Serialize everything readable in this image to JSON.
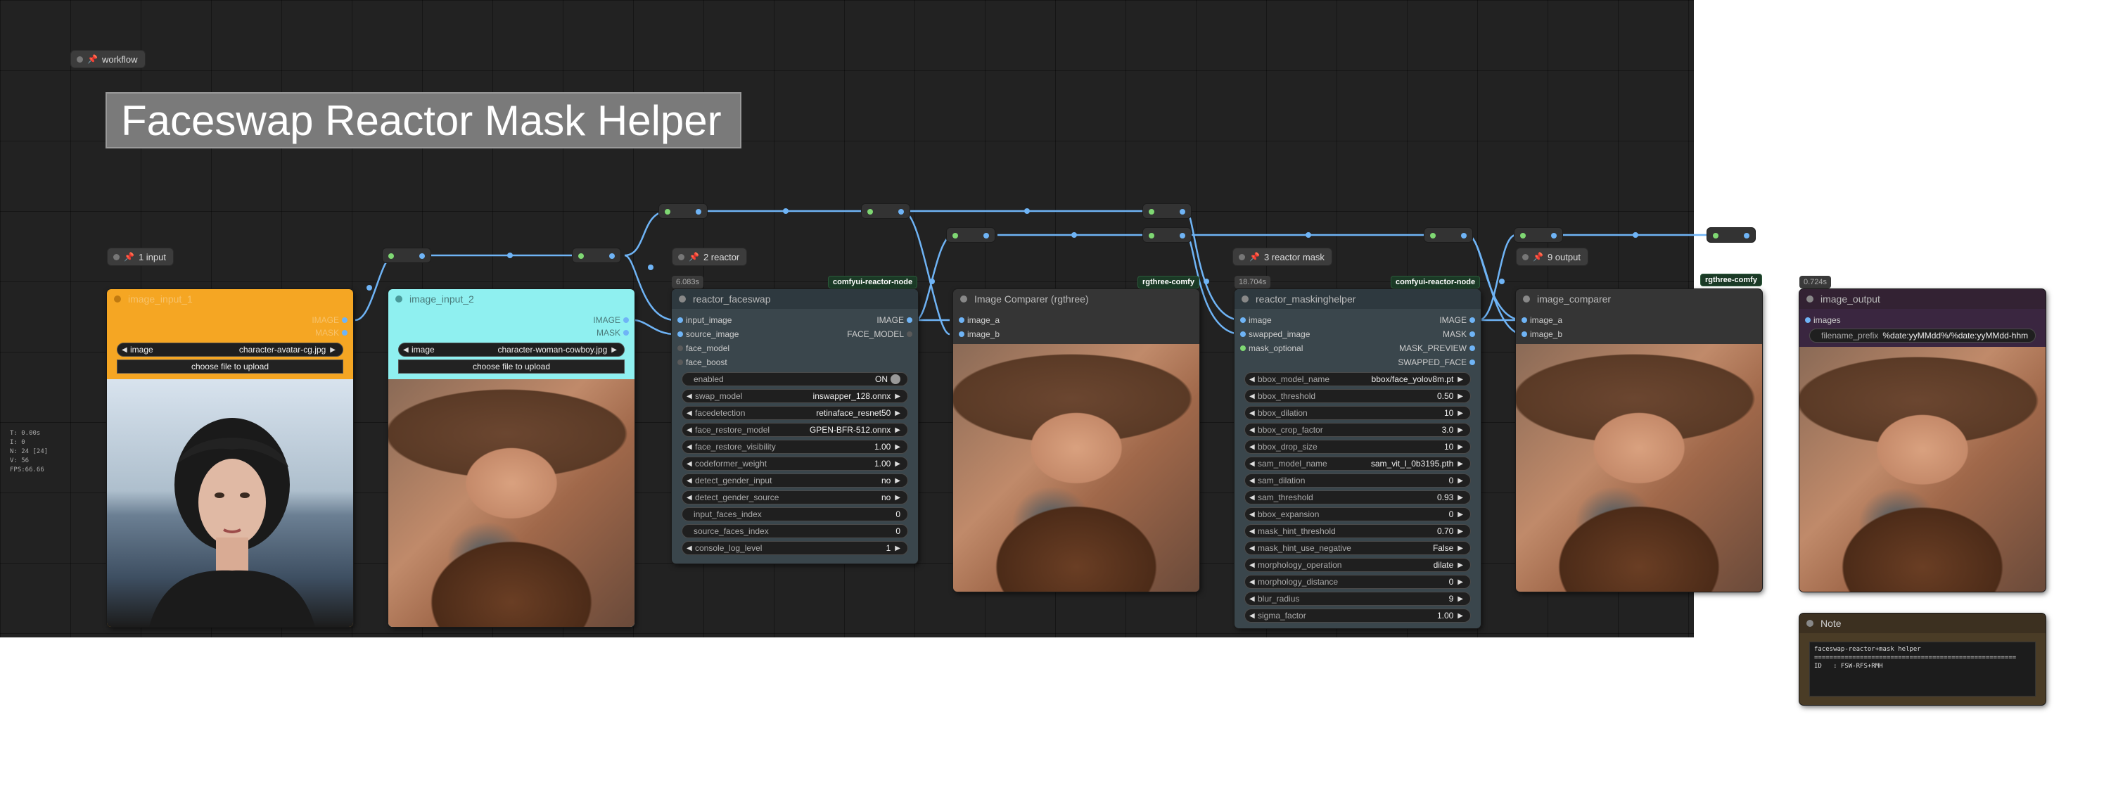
{
  "workflow_label": "workflow",
  "title": "Faceswap Reactor Mask Helper",
  "colors": {
    "orange": "#f5a623",
    "cyan": "#8ff0f0",
    "link": "#6fb4f6",
    "purple": "#3a2640",
    "note": "#4a3c26"
  },
  "stats": [
    "T: 0.00s",
    "I: 0",
    "N: 24 [24]",
    "V: 56",
    "FPS:66.66"
  ],
  "groups": {
    "input": "1 input",
    "reactor": "2 reactor",
    "reactor_mask": "3 reactor mask",
    "output": "9 output"
  },
  "nodes": {
    "image_input_1": {
      "title": "image_input_1",
      "outputs": [
        "IMAGE",
        "MASK"
      ],
      "image_label": "image",
      "image_value": "character-avatar-cg.jpg",
      "upload": "choose file to upload"
    },
    "image_input_2": {
      "title": "image_input_2",
      "outputs": [
        "IMAGE",
        "MASK"
      ],
      "image_label": "image",
      "image_value": "character-woman-cowboy.jpg",
      "upload": "choose file to upload"
    },
    "reactor_faceswap": {
      "time": "6.083s",
      "pack": "comfyui-reactor-node",
      "title": "reactor_faceswap",
      "inputs": [
        "input_image",
        "source_image",
        "face_model",
        "face_boost"
      ],
      "outputs": [
        "IMAGE",
        "FACE_MODEL"
      ],
      "widgets": [
        {
          "label": "enabled",
          "value": "ON"
        },
        {
          "label": "swap_model",
          "value": "inswapper_128.onnx"
        },
        {
          "label": "facedetection",
          "value": "retinaface_resnet50"
        },
        {
          "label": "face_restore_model",
          "value": "GPEN-BFR-512.onnx"
        },
        {
          "label": "face_restore_visibility",
          "value": "1.00"
        },
        {
          "label": "codeformer_weight",
          "value": "1.00"
        },
        {
          "label": "detect_gender_input",
          "value": "no"
        },
        {
          "label": "detect_gender_source",
          "value": "no"
        },
        {
          "label": "input_faces_index",
          "value": "0"
        },
        {
          "label": "source_faces_index",
          "value": "0"
        },
        {
          "label": "console_log_level",
          "value": "1"
        }
      ]
    },
    "image_comparer_1": {
      "pack": "rgthree-comfy",
      "title": "Image Comparer (rgthree)",
      "inputs": [
        "image_a",
        "image_b"
      ]
    },
    "reactor_maskinghelper": {
      "time": "18.704s",
      "pack": "comfyui-reactor-node",
      "title": "reactor_maskinghelper",
      "inputs": [
        "image",
        "swapped_image",
        "mask_optional"
      ],
      "outputs": [
        "IMAGE",
        "MASK",
        "MASK_PREVIEW",
        "SWAPPED_FACE"
      ],
      "widgets": [
        {
          "label": "bbox_model_name",
          "value": "bbox/face_yolov8m.pt"
        },
        {
          "label": "bbox_threshold",
          "value": "0.50"
        },
        {
          "label": "bbox_dilation",
          "value": "10"
        },
        {
          "label": "bbox_crop_factor",
          "value": "3.0"
        },
        {
          "label": "bbox_drop_size",
          "value": "10"
        },
        {
          "label": "sam_model_name",
          "value": "sam_vit_l_0b3195.pth"
        },
        {
          "label": "sam_dilation",
          "value": "0"
        },
        {
          "label": "sam_threshold",
          "value": "0.93"
        },
        {
          "label": "bbox_expansion",
          "value": "0"
        },
        {
          "label": "mask_hint_threshold",
          "value": "0.70"
        },
        {
          "label": "mask_hint_use_negative",
          "value": "False"
        },
        {
          "label": "morphology_operation",
          "value": "dilate"
        },
        {
          "label": "morphology_distance",
          "value": "0"
        },
        {
          "label": "blur_radius",
          "value": "9"
        },
        {
          "label": "sigma_factor",
          "value": "1.00"
        }
      ]
    },
    "image_comparer_2": {
      "pack": "rgthree-comfy",
      "title": "image_comparer",
      "inputs": [
        "image_a",
        "image_b"
      ]
    },
    "image_output": {
      "time": "0.724s",
      "title": "image_output",
      "inputs": [
        "images"
      ],
      "filename_label": "filename_prefix",
      "filename_value": "%date:yyMMdd%/%date:yyMMdd-hhm"
    },
    "note": {
      "title": "Note",
      "text": "faceswap-reactor+mask helper\n=====================================================\nID   : FSW-RFS+RMH"
    }
  }
}
